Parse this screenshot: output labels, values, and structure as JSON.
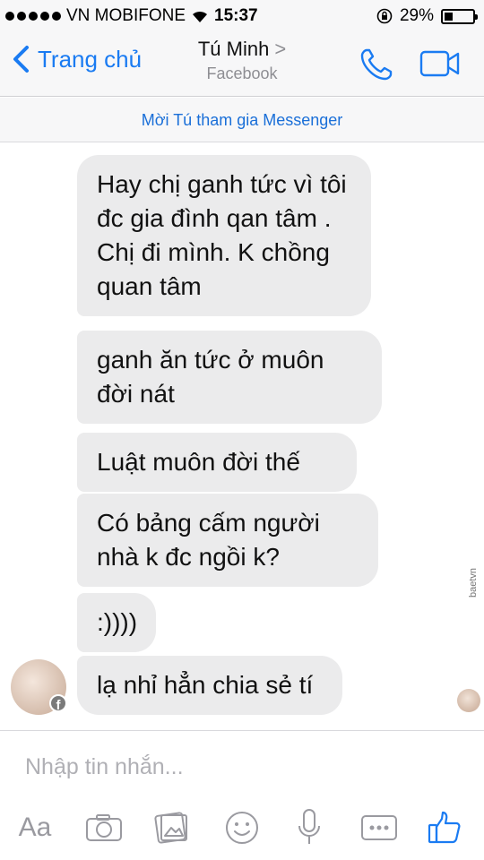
{
  "status_bar": {
    "carrier": "VN MOBIFONE",
    "time": "15:37",
    "battery_text": "29%",
    "battery_level": 0.29
  },
  "nav": {
    "back_label": "Trang chủ",
    "contact_name": "Tú Minh",
    "contact_chevron": ">",
    "contact_subtitle": "Facebook",
    "icons": [
      "phone-icon",
      "video-camera-icon"
    ]
  },
  "invite_banner": "Mời Tú tham gia Messenger",
  "messages": [
    "Hay chị ganh tức vì tôi đc gia đình qan tâm . Chị đi mình. K chồng quan tâm",
    "ganh ăn tức ở muôn đời nát",
    "Luật muôn đời thế",
    "Có bảng cấm người nhà k đc ngồi k?",
    ":))))",
    "lạ nhỉ hẳn chia sẻ tí"
  ],
  "avatar_badge": "f",
  "watermark": "baetvn",
  "composer": {
    "placeholder": "Nhập tin nhắn...",
    "text_format_label": "Aa",
    "tools": [
      "text-format-icon",
      "camera-icon",
      "gallery-icon",
      "emoji-icon",
      "microphone-icon",
      "more-icon",
      "like-icon"
    ]
  },
  "colors": {
    "accent": "#1a7bf2",
    "bubble": "#ebebec",
    "bar": "#f7f7f8"
  }
}
